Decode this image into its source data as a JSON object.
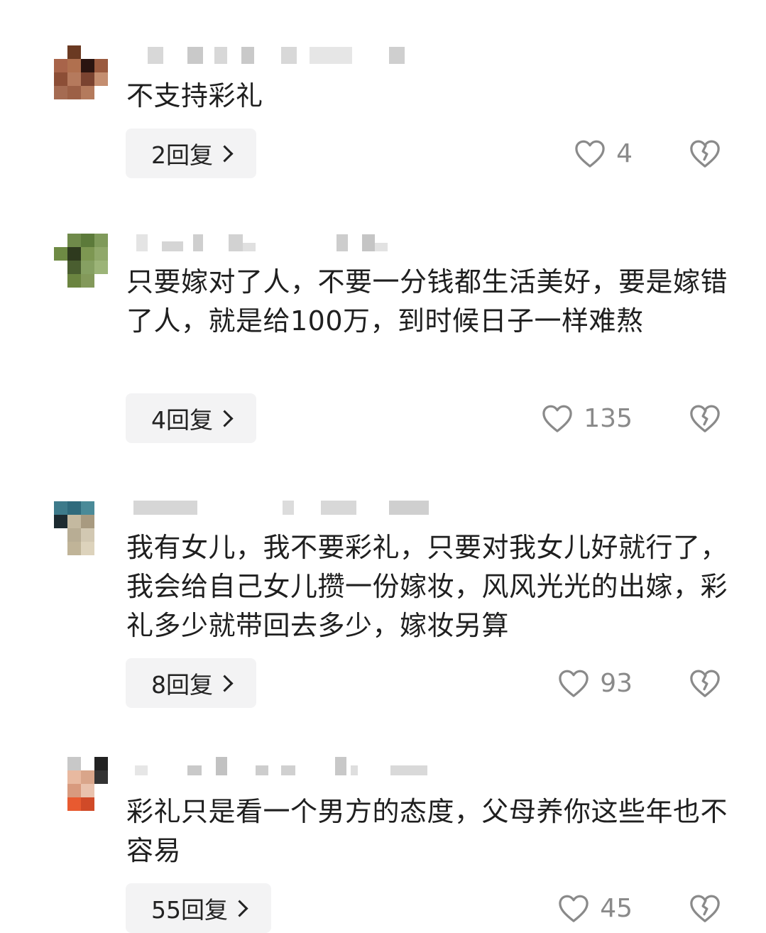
{
  "comments": [
    {
      "text": "不支持彩礼",
      "reply_label": "2回复",
      "likes": "4"
    },
    {
      "text": "只要嫁对了人，不要一分钱都生活美好，要是嫁错了人，就是给100万，到时候日子一样难熬",
      "reply_label": "4回复",
      "likes": "135"
    },
    {
      "text": "我有女儿，我不要彩礼，只要对我女儿好就行了，我会给自己女儿攒一份嫁妆，风风光光的出嫁，彩礼多少就带回去多少，嫁妆另算",
      "reply_label": "8回复",
      "likes": "93"
    },
    {
      "text": "彩礼只是看一个男方的态度，父母养你这些年也不容易",
      "reply_label": "55回复",
      "likes": "45"
    }
  ],
  "icons": {
    "like": "heart-outline-icon",
    "dislike": "broken-heart-icon",
    "reply_arrow": "chevron-right-icon"
  },
  "colors": {
    "reply_bg": "#f3f3f4",
    "icon_gray": "#8a8a8a",
    "text": "#1f1f1f"
  }
}
